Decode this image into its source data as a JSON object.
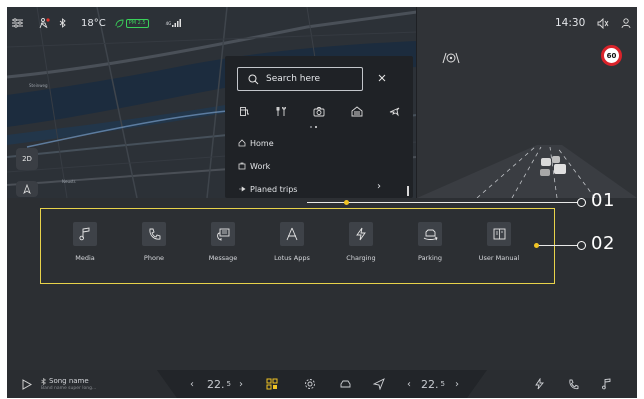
{
  "status_bar": {
    "temperature": "18°C",
    "aqi_badge": "PM 2.5",
    "signal_badge": "4G",
    "time": "14:30"
  },
  "map": {
    "view_mode": "2D",
    "road_labels": [
      "Steinweg",
      "Neustr."
    ]
  },
  "search_panel": {
    "placeholder": "Search here",
    "categories": [
      "charging",
      "restaurant",
      "camera",
      "parking",
      "airport"
    ],
    "items": [
      {
        "label": "Home",
        "icon": "home-icon"
      },
      {
        "label": "Work",
        "icon": "work-icon"
      },
      {
        "label": "Planed trips",
        "icon": "trips-icon"
      }
    ]
  },
  "camera_view": {
    "speed_limit": "60"
  },
  "callouts": {
    "label_1": "01",
    "label_2": "02"
  },
  "apps": [
    {
      "label": "Media",
      "icon": "music-note-icon"
    },
    {
      "label": "Phone",
      "icon": "phone-icon"
    },
    {
      "label": "Message",
      "icon": "message-icon"
    },
    {
      "label": "Lotus Apps",
      "icon": "apps-icon"
    },
    {
      "label": "Charging",
      "icon": "lightning-icon"
    },
    {
      "label": "Parking",
      "icon": "parking-icon"
    },
    {
      "label": "User Manual",
      "icon": "book-icon"
    }
  ],
  "bottom_bar": {
    "song_name": "Song name",
    "song_artist": "Band name super long...",
    "temp_left": "22.",
    "temp_left_unit": "5",
    "temp_right": "22.",
    "temp_right_unit": "5"
  },
  "colors": {
    "accent_yellow": "#e8d24a",
    "background": "#2c2f33",
    "speed_sign_ring": "#d9232a"
  }
}
